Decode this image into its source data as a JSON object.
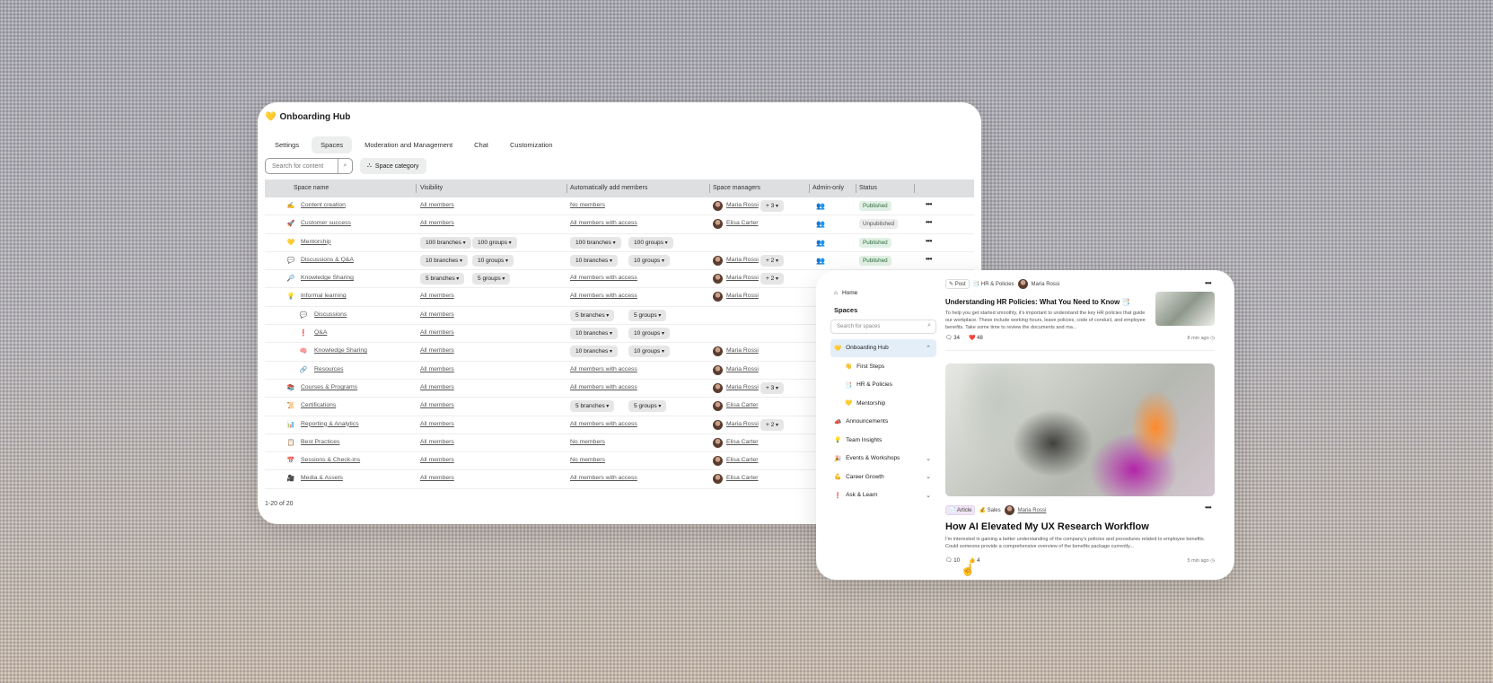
{
  "admin": {
    "title": "Onboarding Hub",
    "tabs": [
      "Settings",
      "Spaces",
      "Moderation and Management",
      "Chat",
      "Customization"
    ],
    "search_placeholder": "Search for content",
    "category_button": "Space category",
    "columns": [
      "Space name",
      "Visibility",
      "Automatically add members",
      "Space managers",
      "Admin-only",
      "Status"
    ],
    "rows": [
      {
        "icon": "✍",
        "name": "Content creation",
        "vis": "All members",
        "vis_pills": [],
        "auto": "No members",
        "auto_pills": [],
        "mgr": "Maria Rossi",
        "more": "+ 3",
        "admin": true,
        "status": "Published"
      },
      {
        "icon": "🚀",
        "name": "Customer success",
        "vis": "All members",
        "vis_pills": [],
        "auto": "All members with access",
        "auto_pills": [],
        "mgr": "Elisa Carter",
        "more": "",
        "admin": true,
        "status": "Unpublished"
      },
      {
        "icon": "💛",
        "name": "Mentorship",
        "vis": "",
        "vis_pills": [
          "100 branches",
          "100 groups"
        ],
        "auto": "",
        "auto_pills": [
          "100 branches",
          "100 groups"
        ],
        "mgr": "",
        "more": "",
        "admin": true,
        "status": "Published"
      },
      {
        "icon": "💬",
        "name": "Discussions & Q&A",
        "vis": "",
        "vis_pills": [
          "10 branches",
          "10 groups"
        ],
        "auto": "",
        "auto_pills": [
          "10 branches",
          "10 groups"
        ],
        "mgr": "Maria Rossi",
        "more": "+ 2",
        "admin": true,
        "status": "Published"
      },
      {
        "icon": "🔎",
        "name": "Knowledge Sharing",
        "vis": "",
        "vis_pills": [
          "5 branches",
          "5 groups"
        ],
        "auto": "All members with access",
        "auto_pills": [],
        "mgr": "Maria Rossi",
        "more": "+ 2",
        "admin": false,
        "status": ""
      },
      {
        "icon": "💡",
        "name": "Informal learning",
        "vis": "All members",
        "vis_pills": [],
        "auto": "All members with access",
        "auto_pills": [],
        "mgr": "Maria Rossi",
        "more": "",
        "admin": false,
        "status": ""
      },
      {
        "icon": "💬",
        "name": "Discussions",
        "vis": "All members",
        "vis_pills": [],
        "auto": "",
        "auto_pills": [
          "5 branches",
          "5 groups"
        ],
        "mgr": "",
        "more": "",
        "admin": false,
        "status": "",
        "sub": true
      },
      {
        "icon": "❗",
        "name": "Q&A",
        "vis": "All members",
        "vis_pills": [],
        "auto": "",
        "auto_pills": [
          "10 branches",
          "10 groups"
        ],
        "mgr": "",
        "more": "",
        "admin": false,
        "status": "",
        "sub": true
      },
      {
        "icon": "🧠",
        "name": "Knowledge Sharing",
        "vis": "All members",
        "vis_pills": [],
        "auto": "",
        "auto_pills": [
          "10 branches",
          "10 groups"
        ],
        "mgr": "Maria Rossi",
        "more": "",
        "admin": false,
        "status": "",
        "sub": true
      },
      {
        "icon": "🔗",
        "name": "Resources",
        "vis": "All members",
        "vis_pills": [],
        "auto": "All members with access",
        "auto_pills": [],
        "mgr": "Maria Rossi",
        "more": "",
        "admin": false,
        "status": "",
        "sub": true
      },
      {
        "icon": "📚",
        "name": "Courses & Programs",
        "vis": "All members",
        "vis_pills": [],
        "auto": "All members with access",
        "auto_pills": [],
        "mgr": "Maria Rossi",
        "more": "+ 3",
        "admin": false,
        "status": ""
      },
      {
        "icon": "📜",
        "name": "Certifications",
        "vis": "All members",
        "vis_pills": [],
        "auto": "",
        "auto_pills": [
          "5 branches",
          "5 groups"
        ],
        "mgr": "Elisa Carter",
        "more": "",
        "admin": false,
        "status": ""
      },
      {
        "icon": "📊",
        "name": "Reporting & Analytics",
        "vis": "All members",
        "vis_pills": [],
        "auto": "All members with access",
        "auto_pills": [],
        "mgr": "Maria Rossi",
        "more": "+ 2",
        "admin": false,
        "status": ""
      },
      {
        "icon": "📋",
        "name": "Best Practices",
        "vis": "All members",
        "vis_pills": [],
        "auto": "No members",
        "auto_pills": [],
        "mgr": "Elisa Carter",
        "more": "",
        "admin": false,
        "status": ""
      },
      {
        "icon": "📅",
        "name": "Sessions & Check-ins",
        "vis": "All members",
        "vis_pills": [],
        "auto": "No members",
        "auto_pills": [],
        "mgr": "Elisa Carter",
        "more": "",
        "admin": false,
        "status": ""
      },
      {
        "icon": "🎥",
        "name": "Media & Assets",
        "vis": "All members",
        "vis_pills": [],
        "auto": "All members with access",
        "auto_pills": [],
        "mgr": "Elisa Carter",
        "more": "",
        "admin": false,
        "status": ""
      }
    ],
    "pagination": "1-20 of 20"
  },
  "community": {
    "home": "Home",
    "spaces_heading": "Spaces",
    "search_placeholder": "Search for spaces",
    "nav": [
      {
        "icon": "💛",
        "label": "Onboarding Hub",
        "chev": "⌃",
        "active": true,
        "sub": false
      },
      {
        "icon": "👋",
        "label": "First Steps",
        "chev": "",
        "active": false,
        "sub": true
      },
      {
        "icon": "📑",
        "label": "HR & Policies",
        "chev": "",
        "active": false,
        "sub": true
      },
      {
        "icon": "💛",
        "label": "Mentorship",
        "chev": "",
        "active": false,
        "sub": true
      },
      {
        "icon": "📣",
        "label": "Announcements",
        "chev": "",
        "active": false,
        "sub": false
      },
      {
        "icon": "💡",
        "label": "Team Insights",
        "chev": "",
        "active": false,
        "sub": false
      },
      {
        "icon": "🎉",
        "label": "Events & Workshops",
        "chev": "⌄",
        "active": false,
        "sub": false
      },
      {
        "icon": "💪",
        "label": "Career Growth",
        "chev": "⌄",
        "active": false,
        "sub": false
      },
      {
        "icon": "❗",
        "label": "Ask & Learn",
        "chev": "⌄",
        "active": false,
        "sub": false
      }
    ],
    "post1": {
      "type": "Post",
      "space": "HR & Policies",
      "author": "Maria Rossi",
      "title": "Understanding HR Policies: What You Need to Know 📑",
      "body": "To help you get started smoothly, it's important to understand the key HR policies that guide our workplace. These include working hours, leave policies, code of conduct, and employee benefits. Take some time to review the documents and ma...",
      "comments": "34",
      "likes": "48",
      "time": "8 min ago"
    },
    "post2": {
      "type": "Article",
      "space": "Sales",
      "author": "Maria Rossi",
      "title": "How AI Elevated My UX Research Workflow",
      "body": "I'm interested in gaining a better understanding of the company's policies and procedures related to employee benefits. Could someone provide a comprehensive overview of the benefits package currently...",
      "comments": "10",
      "likes": "4",
      "time": "5 min ago"
    }
  }
}
